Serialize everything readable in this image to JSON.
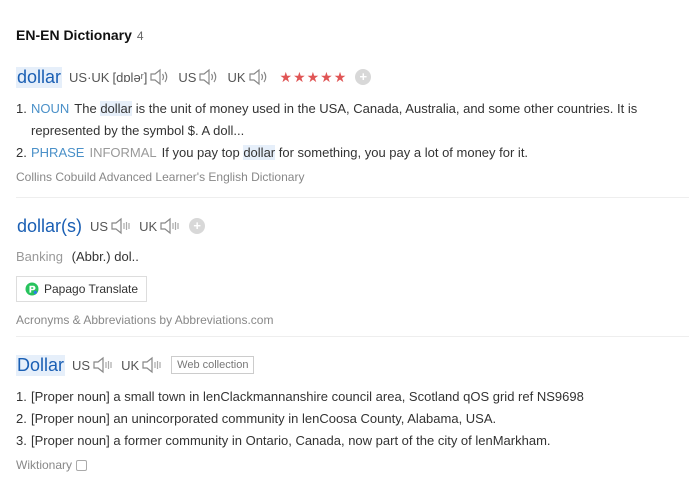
{
  "header": {
    "title": "EN-EN Dictionary",
    "count": "4"
  },
  "entry1": {
    "word": "dollar",
    "pron_label": "US·UK",
    "ipa": "[dɒləʳ]",
    "us_label": "US",
    "uk_label": "UK",
    "stars": "★★★★★",
    "defs": [
      {
        "num": "1.",
        "pos": "NOUN",
        "pre": "The",
        "hl": "dollar",
        "post": "is the unit of money used in the USA, Canada, Australia, and some other countries. It is represented by the symbol $. A doll..."
      },
      {
        "num": "2.",
        "pos": "PHRASE",
        "register": "INFORMAL",
        "pre": "If you pay top",
        "hl": "dollar",
        "post": "for something, you pay a lot of money for it."
      }
    ],
    "source": "Collins Cobuild Advanced Learner's English Dictionary"
  },
  "entry2": {
    "word": "dollar(s)",
    "us_label": "US",
    "uk_label": "UK",
    "category": "Banking",
    "text": "(Abbr.) dol..",
    "papago_label": "Papago Translate",
    "source": "Acronyms & Abbreviations by Abbreviations.com"
  },
  "entry3": {
    "word": "Dollar",
    "us_label": "US",
    "uk_label": "UK",
    "badge": "Web collection",
    "defs": [
      {
        "num": "1.",
        "text": "[Proper noun] a small town in lenClackmannanshire council area, Scotland qOS grid ref NS9698"
      },
      {
        "num": "2.",
        "text": "[Proper noun] an unincorporated community in lenCoosa County, Alabama, USA."
      },
      {
        "num": "3.",
        "text": "[Proper noun] a former community in Ontario, Canada, now part of the city of lenMarkham."
      }
    ],
    "source": "Wiktionary"
  },
  "icons": {
    "speaker": "speaker-icon",
    "add": "plus-icon",
    "papago": "papago-logo-icon",
    "external": "external-link-icon"
  },
  "colors": {
    "headword": "#1a5fb4",
    "pos": "#4a90c8",
    "stars": "#e05555",
    "highlight": "#e6effa"
  }
}
